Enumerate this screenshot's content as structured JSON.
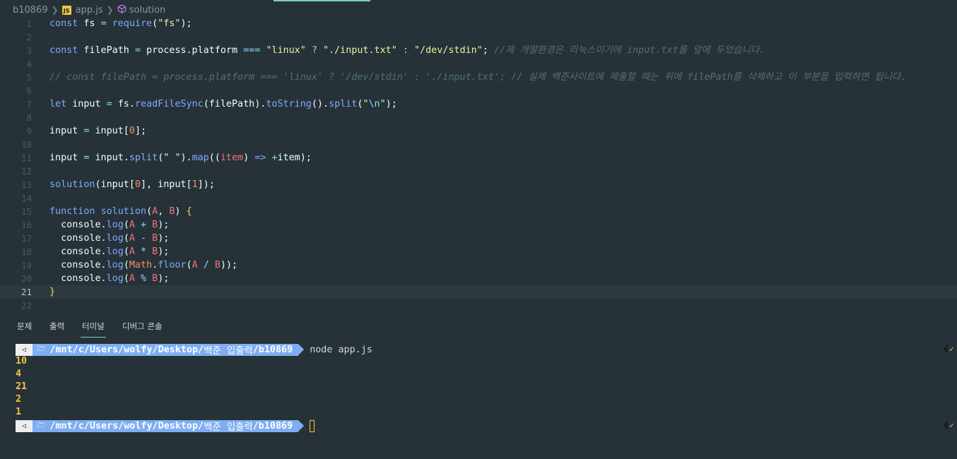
{
  "breadcrumb": {
    "folder": "b10869",
    "file": "app.js",
    "file_icon": "JS",
    "symbol": "solution"
  },
  "editor": {
    "current_line": 21,
    "line_numbers": [
      "1",
      "2",
      "3",
      "4",
      "5",
      "6",
      "7",
      "8",
      "9",
      "10",
      "11",
      "12",
      "13",
      "14",
      "15",
      "16",
      "17",
      "18",
      "19",
      "20",
      "21",
      "22"
    ],
    "lines": [
      [
        [
          "kw",
          "const"
        ],
        [
          "ident",
          " fs "
        ],
        [
          "op",
          "="
        ],
        [
          "ident",
          " "
        ],
        [
          "fn",
          "require"
        ],
        [
          "ident",
          "("
        ],
        [
          "str",
          "\"fs\""
        ],
        [
          "ident",
          ");"
        ]
      ],
      [],
      [
        [
          "kw",
          "const"
        ],
        [
          "ident",
          " filePath "
        ],
        [
          "op",
          "="
        ],
        [
          "ident",
          " process.platform "
        ],
        [
          "op",
          "==="
        ],
        [
          "ident",
          " "
        ],
        [
          "str",
          "\"linux\""
        ],
        [
          "ident",
          " "
        ],
        [
          "op",
          "?"
        ],
        [
          "ident",
          " "
        ],
        [
          "str",
          "\"./input.txt\""
        ],
        [
          "ident",
          " "
        ],
        [
          "op",
          ":"
        ],
        [
          "ident",
          " "
        ],
        [
          "str",
          "\"/dev/stdin\""
        ],
        [
          "ident",
          "; "
        ],
        [
          "cm",
          "//제 개발환경은 리눅스이기에 input.txt를 앞에 두었습니다."
        ]
      ],
      [],
      [
        [
          "cm",
          "// const filePath = process.platform === 'linux' ? '/dev/stdin' : './input.txt'; // 실제 백준사이트에 제출할 때는 위에 filePath를 삭제하고 이 부분을 입력하면 됩니다."
        ]
      ],
      [],
      [
        [
          "kw",
          "let"
        ],
        [
          "ident",
          " input "
        ],
        [
          "op",
          "="
        ],
        [
          "ident",
          " fs."
        ],
        [
          "fn",
          "readFileSync"
        ],
        [
          "ident",
          "(filePath)."
        ],
        [
          "fn",
          "toString"
        ],
        [
          "ident",
          "()."
        ],
        [
          "fn",
          "split"
        ],
        [
          "ident",
          "("
        ],
        [
          "str",
          "\""
        ],
        [
          "esc",
          "\\n"
        ],
        [
          "str",
          "\""
        ],
        [
          "ident",
          ");"
        ]
      ],
      [],
      [
        [
          "ident",
          "input "
        ],
        [
          "op",
          "="
        ],
        [
          "ident",
          " input["
        ],
        [
          "num",
          "0"
        ],
        [
          "ident",
          "];"
        ]
      ],
      [],
      [
        [
          "ident",
          "input "
        ],
        [
          "op",
          "="
        ],
        [
          "ident",
          " input."
        ],
        [
          "fn",
          "split"
        ],
        [
          "ident",
          "("
        ],
        [
          "str",
          "\" \""
        ],
        [
          "ident",
          ")."
        ],
        [
          "fn",
          "map"
        ],
        [
          "ident",
          "(("
        ],
        [
          "prm",
          "item"
        ],
        [
          "ident",
          ") "
        ],
        [
          "kw",
          "=>"
        ],
        [
          "ident",
          " "
        ],
        [
          "op",
          "+"
        ],
        [
          "ident",
          "item);"
        ]
      ],
      [],
      [
        [
          "fn",
          "solution"
        ],
        [
          "ident",
          "(input["
        ],
        [
          "num",
          "0"
        ],
        [
          "ident",
          "], input["
        ],
        [
          "num",
          "1"
        ],
        [
          "ident",
          "]);"
        ]
      ],
      [],
      [
        [
          "kw",
          "function"
        ],
        [
          "ident",
          " "
        ],
        [
          "fn",
          "solution"
        ],
        [
          "ident",
          "("
        ],
        [
          "prm",
          "A"
        ],
        [
          "ident",
          ", "
        ],
        [
          "prm",
          "B"
        ],
        [
          "ident",
          ") "
        ],
        [
          "brk",
          "{"
        ]
      ],
      [
        [
          "ident",
          "  console."
        ],
        [
          "fn",
          "log"
        ],
        [
          "ident",
          "("
        ],
        [
          "prm",
          "A"
        ],
        [
          "ident",
          " "
        ],
        [
          "op",
          "+"
        ],
        [
          "ident",
          " "
        ],
        [
          "prm",
          "B"
        ],
        [
          "ident",
          ");"
        ]
      ],
      [
        [
          "ident",
          "  console."
        ],
        [
          "fn",
          "log"
        ],
        [
          "ident",
          "("
        ],
        [
          "prm",
          "A"
        ],
        [
          "ident",
          " "
        ],
        [
          "op",
          "-"
        ],
        [
          "ident",
          " "
        ],
        [
          "prm",
          "B"
        ],
        [
          "ident",
          ");"
        ]
      ],
      [
        [
          "ident",
          "  console."
        ],
        [
          "fn",
          "log"
        ],
        [
          "ident",
          "("
        ],
        [
          "prm",
          "A"
        ],
        [
          "ident",
          " "
        ],
        [
          "op",
          "*"
        ],
        [
          "ident",
          " "
        ],
        [
          "prm",
          "B"
        ],
        [
          "ident",
          ");"
        ]
      ],
      [
        [
          "ident",
          "  console."
        ],
        [
          "fn",
          "log"
        ],
        [
          "ident",
          "("
        ],
        [
          "cls",
          "Math"
        ],
        [
          "ident",
          "."
        ],
        [
          "fn",
          "floor"
        ],
        [
          "ident",
          "("
        ],
        [
          "prm",
          "A"
        ],
        [
          "ident",
          " "
        ],
        [
          "op",
          "/"
        ],
        [
          "ident",
          " "
        ],
        [
          "prm",
          "B"
        ],
        [
          "ident",
          "));"
        ]
      ],
      [
        [
          "ident",
          "  console."
        ],
        [
          "fn",
          "log"
        ],
        [
          "ident",
          "("
        ],
        [
          "prm",
          "A"
        ],
        [
          "ident",
          " "
        ],
        [
          "op",
          "%"
        ],
        [
          "ident",
          " "
        ],
        [
          "prm",
          "B"
        ],
        [
          "ident",
          ");"
        ]
      ],
      [
        [
          "brk",
          "}"
        ]
      ],
      []
    ]
  },
  "panel": {
    "tabs": [
      "문제",
      "출력",
      "터미널",
      "디버그 콘솔"
    ],
    "active_tab": "터미널"
  },
  "terminal": {
    "prompt_path_prefix": "/mnt/c/Users/wolfy/Desktop/",
    "prompt_path_dir": "백준 입출력",
    "prompt_path_bold": "/b10869",
    "command": "node app.js",
    "outputs": [
      "10",
      "4",
      "21",
      "2",
      "1"
    ]
  },
  "colors": {
    "background": "#263238",
    "prompt_path_bg": "#7eaef2",
    "output": "#f5c542",
    "active_tab_underline": "#80cbc4"
  }
}
